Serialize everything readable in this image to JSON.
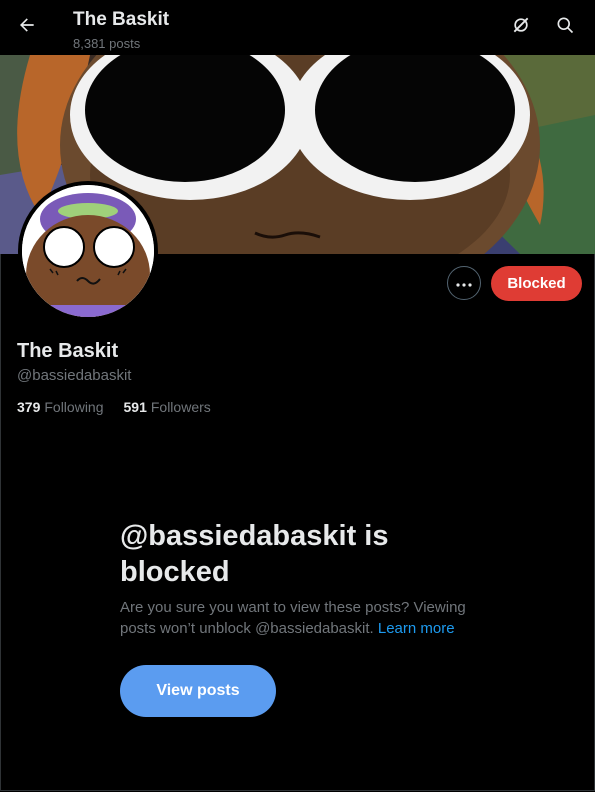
{
  "header": {
    "title": "The Baskit",
    "posts_count": "8,381 posts",
    "back_icon": "arrow-left-icon",
    "grok_icon": "grok-slash-icon",
    "search_icon": "search-icon"
  },
  "profile": {
    "name": "The Baskit",
    "handle": "@bassiedabaskit",
    "following_count": "379",
    "following_label": "Following",
    "followers_count": "591",
    "followers_label": "Followers",
    "more_icon": "more-horizontal-icon",
    "blocked_label": "Blocked"
  },
  "notice": {
    "title": "@bassiedabaskit is blocked",
    "body": "Are you sure you want to view these posts? Viewing posts won’t unblock @bassiedabaskit.",
    "learn_more": "Learn more",
    "view_button": "View posts"
  },
  "colors": {
    "background": "#000000",
    "blocked_red": "#df3c34",
    "view_blue": "#5b9cf0",
    "link_blue": "#1d9bf0",
    "muted": "#71767b"
  }
}
